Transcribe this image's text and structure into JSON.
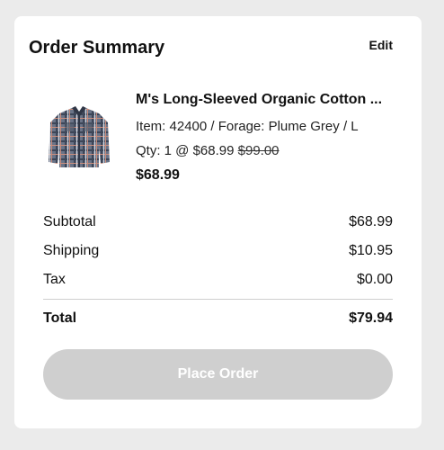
{
  "header": {
    "title": "Order Summary",
    "edit_label": "Edit"
  },
  "product": {
    "name": "M's Long-Sleeved Organic Cotton ...",
    "item_line": "Item: 42400 / Forage: Plume Grey / L",
    "qty_prefix": "Qty: 1 @ ",
    "price": "$68.99",
    "original_price": "$99.00",
    "line_total": "$68.99",
    "image_icon": "flannel-shirt-image"
  },
  "summary": {
    "subtotal_label": "Subtotal",
    "subtotal_value": "$68.99",
    "shipping_label": "Shipping",
    "shipping_value": "$10.95",
    "tax_label": "Tax",
    "tax_value": "$0.00",
    "total_label": "Total",
    "total_value": "$79.94"
  },
  "actions": {
    "place_order_label": "Place Order"
  },
  "colors": {
    "page_bg": "#ebebeb",
    "card_bg": "#ffffff",
    "disabled_button": "#cfcfcf"
  }
}
